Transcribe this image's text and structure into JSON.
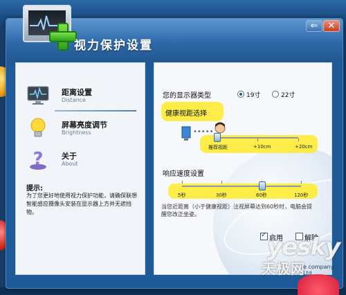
{
  "window": {
    "title": "视力保护设置",
    "back_glyph": "⇐",
    "close_glyph": "✕"
  },
  "sidebar": {
    "items": [
      {
        "label": "距离设置",
        "sub": "Distance"
      },
      {
        "label": "屏幕亮度调节",
        "sub": "Brightness"
      },
      {
        "label": "关于",
        "sub": "About"
      }
    ],
    "tip_title": "提示:",
    "tip_text": "为了您更好地使用视力保护功能，请确保联想智能感应摄像头安装在显示器上方并无遮挡物。"
  },
  "display": {
    "label": "您的显示器类型",
    "options": [
      {
        "label": "19寸",
        "selected": true
      },
      {
        "label": "22寸",
        "selected": false
      }
    ]
  },
  "distance": {
    "label": "健康视距选择",
    "dots": "•••••",
    "ticks": [
      "推荐视距",
      "+10cm",
      "+20cm"
    ],
    "value_index": 0
  },
  "response": {
    "label": "响应速度设置",
    "ticks": [
      "5秒",
      "30秒",
      "60秒",
      "120秒"
    ],
    "value_index": 2
  },
  "note": "当您近距离（小于健康视距）注视屏幕达到60秒时，电脑会提醒您改正坐姿。",
  "options": {
    "enable_label": "启用",
    "enable_checked": true,
    "release_label": "解除",
    "release_checked": false
  },
  "watermark": {
    "en": "yesky",
    "cn": "天极网",
    "tail": "e company Ltd."
  },
  "highlight_color": "#ffeb28",
  "accent_color": "#1f5a98"
}
